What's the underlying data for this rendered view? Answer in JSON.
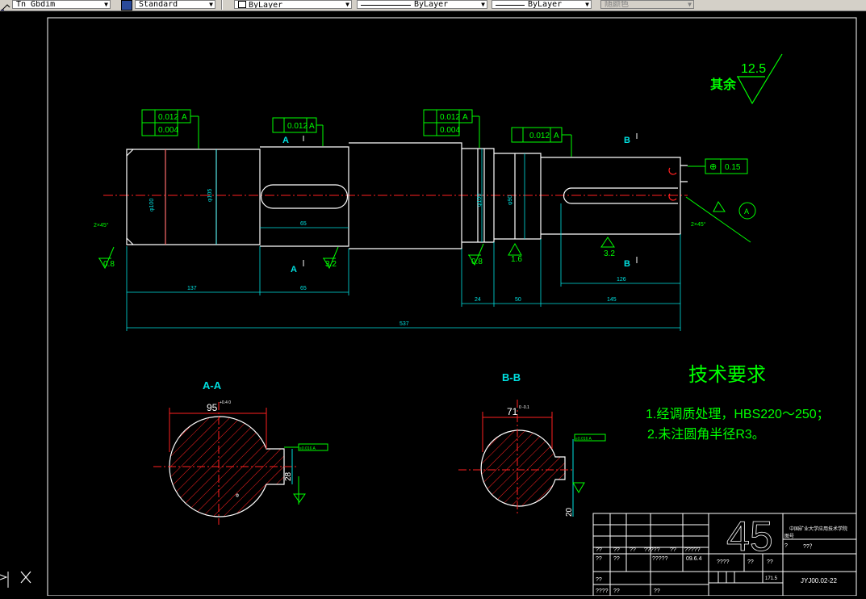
{
  "toolbar": {
    "textstyle": "Tn_Gbdim",
    "dimstyle": "Standard",
    "layer": "ByLayer",
    "linetype": "ByLayer",
    "lineweight": "ByLayer",
    "plotstyle": "随颜色"
  },
  "drawing": {
    "roughness_label": "其余",
    "roughness_value": "12.5",
    "gdt": {
      "runout1": "0.012",
      "datum1": "A",
      "cyl1": "0.004",
      "runout2": "0.012",
      "datum2": "A",
      "runout3": "0.012",
      "datum3": "A",
      "cyl3": "0.004",
      "runout4": "0.012",
      "datum4": "A",
      "sym": "0.15",
      "kt1": "≡0.016 A",
      "kt2": "≡0.016 A"
    },
    "sections": {
      "a_top": "A",
      "a_bottom": "A",
      "b_top": "B",
      "b_bottom": "B",
      "datum_circle": "A"
    },
    "dims": {
      "d1": "137",
      "d2": "65",
      "d3": "24",
      "d4": "50",
      "d5": "145",
      "d6": "126",
      "d_total": "537",
      "key1": "65",
      "chamfer1": "2×45°",
      "chamfer2": "2×45°",
      "dia1": "φ100",
      "dia1b": "+0.065\n+0.043",
      "dia2": "φ105",
      "dia3": "φ100",
      "dia4": "φ90",
      "rough_08a": "0.8",
      "rough_32a": "3.2",
      "rough_08b": "0.8",
      "rough_16": "1.6",
      "rough_32b": "3.2"
    },
    "section_aa_title": "A-A",
    "section_bb_title": "B-B",
    "aa_width": "95",
    "aa_tol": "+0.4\n0",
    "bb_width": "71",
    "bb_tol": "0\n-0.1",
    "aa_key": "28",
    "bb_key": "20",
    "tech_title": "技术要求",
    "tech_line1": "1.经调质处理，HBS220～250；",
    "tech_line2": "2.未注圆角半径R3。",
    "title_block": {
      "material": "45",
      "school": "中国矿业大学应用技术学院",
      "code_label": "图号",
      "part_code": "JYJ00.02-22",
      "name_label": "??？",
      "date": "09.6.4",
      "qs": [
        "??",
        "??",
        "??",
        "?????",
        "??",
        "?????",
        "??",
        "??",
        "?????",
        "??",
        "??",
        "??",
        "????",
        "??",
        "??",
        "??",
        "??",
        "??"
      ],
      "scale": "171.5",
      "mk": "????",
      "m2": "?"
    }
  }
}
